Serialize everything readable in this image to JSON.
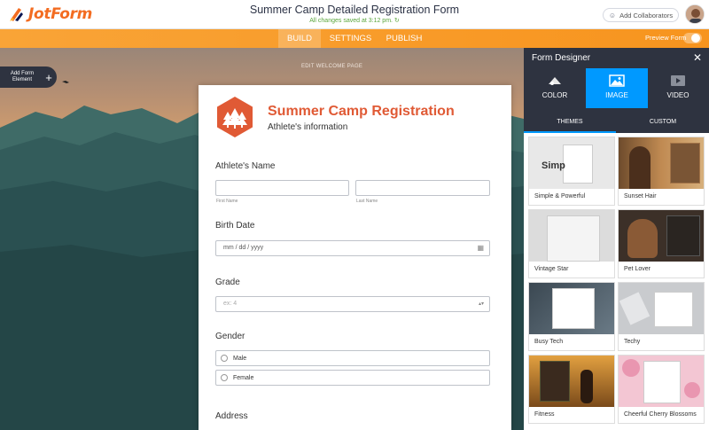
{
  "header": {
    "logo_text": "JotForm",
    "title": "Summer Camp Detailed Registration Form",
    "save_status": "All changes saved at 3:12 pm.",
    "collab_label": "Add Collaborators"
  },
  "nav": {
    "tabs": [
      {
        "label": "BUILD",
        "active": true
      },
      {
        "label": "SETTINGS",
        "active": false
      },
      {
        "label": "PUBLISH",
        "active": false
      }
    ],
    "preview_label": "Preview Form",
    "preview_on": false
  },
  "canvas": {
    "add_element_label": "Add Form Element",
    "welcome_link": "EDIT WELCOME PAGE"
  },
  "form": {
    "title": "Summer Camp Registration",
    "subtitle": "Athlete's information",
    "name_label": "Athlete's Name",
    "first_name_sublabel": "First Name",
    "last_name_sublabel": "Last Name",
    "birth_label": "Birth Date",
    "birth_placeholder": "mm / dd / yyyy",
    "grade_label": "Grade",
    "grade_placeholder": "ex: 4",
    "gender_label": "Gender",
    "gender_options": [
      "Male",
      "Female"
    ],
    "address_label": "Address"
  },
  "panel": {
    "title": "Form Designer",
    "tabs": [
      {
        "label": "COLOR",
        "icon": "palette-icon"
      },
      {
        "label": "IMAGE",
        "icon": "image-icon"
      },
      {
        "label": "VIDEO",
        "icon": "video-icon"
      }
    ],
    "active_tab": "IMAGE",
    "subtabs": [
      "THEMES",
      "CUSTOM"
    ],
    "active_subtab": "THEMES",
    "themes": [
      {
        "name": "Simple & Powerful",
        "thumb_color": "#e8e8e8"
      },
      {
        "name": "Sunset Hair",
        "thumb_color": "#9a6a3c"
      },
      {
        "name": "Vintage Star",
        "thumb_color": "#dcdcdc"
      },
      {
        "name": "Pet Lover",
        "thumb_color": "#4a3a2e"
      },
      {
        "name": "Busy Tech",
        "thumb_color": "#4c5a66"
      },
      {
        "name": "Techy",
        "thumb_color": "#c9cbce"
      },
      {
        "name": "Fitness",
        "thumb_color": "#b8731f"
      },
      {
        "name": "Cheerful Cherry Blossoms",
        "thumb_color": "#f3c6d3"
      }
    ]
  },
  "colors": {
    "brand_orange": "#f7941e",
    "accent_blue": "#0099ff",
    "title_orange": "#e05a35",
    "panel_dark": "#2e3340"
  }
}
